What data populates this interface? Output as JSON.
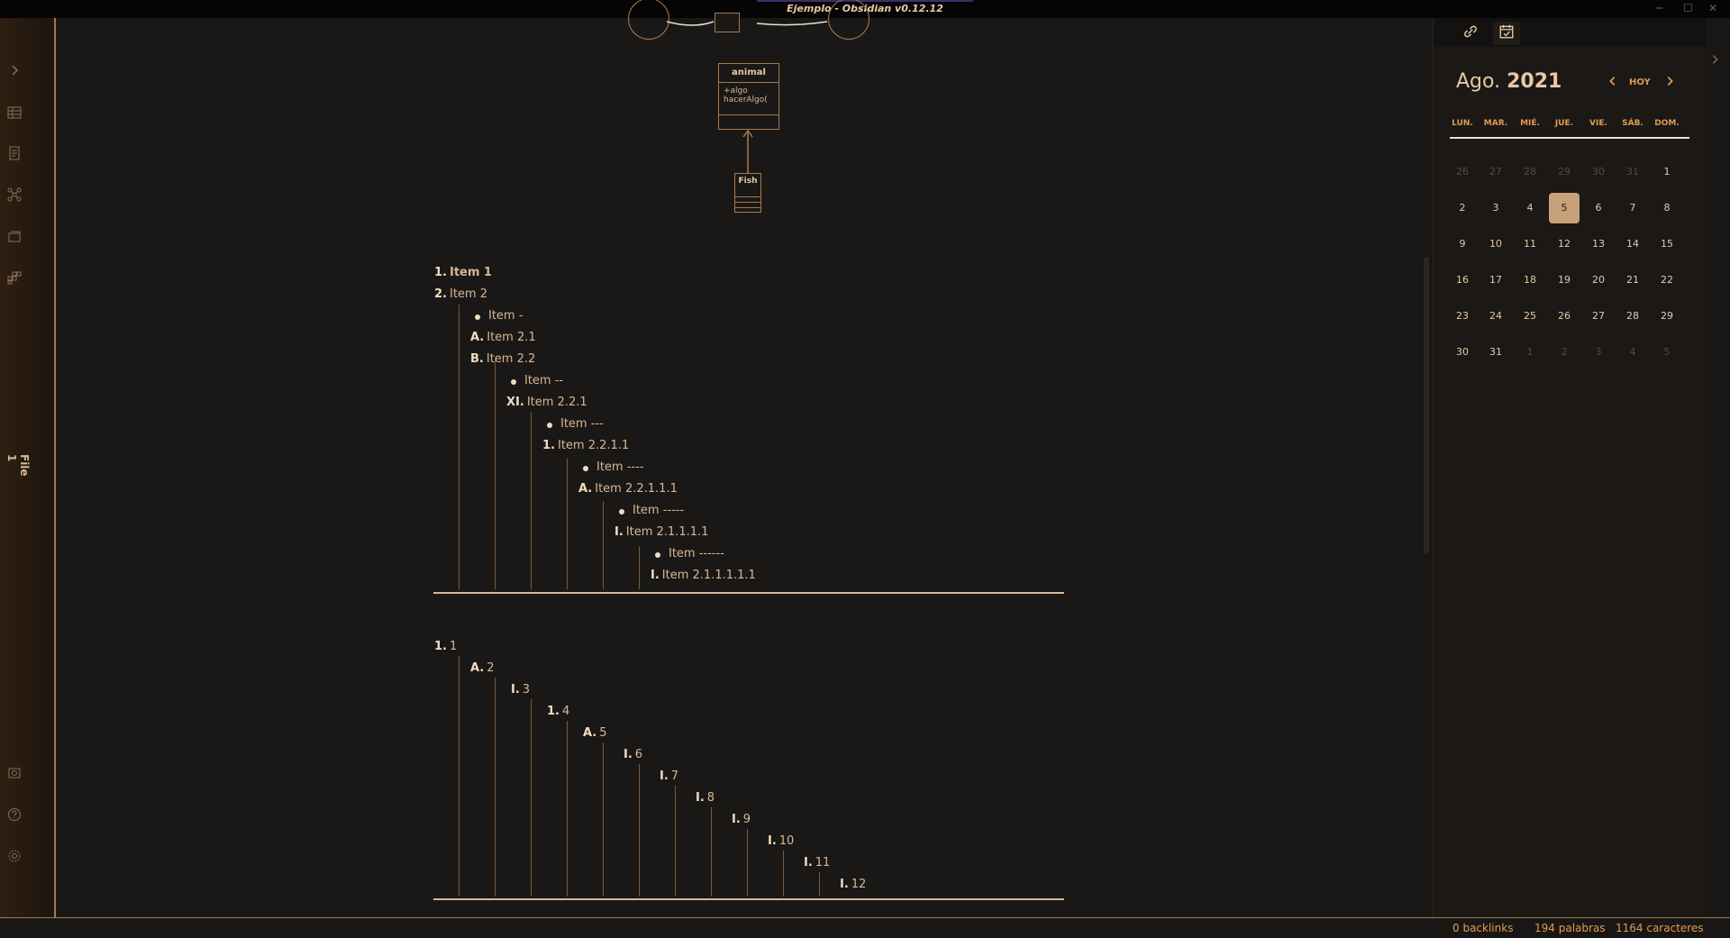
{
  "window": {
    "title": "Ejemplo - Obsidian v0.12.12",
    "minimize": "─",
    "maximize": "☐",
    "close": "✕"
  },
  "ribbon": {
    "file_label": "File 1",
    "icons": [
      "expand-sidebar-icon",
      "table-icon",
      "document-icon",
      "graph-icon",
      "cards-icon",
      "plugins-icon",
      "vault-icon",
      "help-icon",
      "settings-icon"
    ]
  },
  "diagram": {
    "class_name": "animal",
    "members": [
      "+algo",
      "hacerAlgo("
    ],
    "subclass": "Fish"
  },
  "list1": {
    "items": [
      {
        "marker": "1.",
        "text": "Item 1"
      },
      {
        "marker": "2.",
        "text": "Item 2"
      },
      {
        "marker": "",
        "text": "Item -"
      },
      {
        "marker": "A.",
        "text": "Item 2.1"
      },
      {
        "marker": "B.",
        "text": "Item 2.2"
      },
      {
        "marker": "",
        "text": "Item --"
      },
      {
        "marker": "XI.",
        "text": "Item 2.2.1"
      },
      {
        "marker": "",
        "text": "Item ---"
      },
      {
        "marker": "1.",
        "text": "Item 2.2.1.1"
      },
      {
        "marker": "",
        "text": "Item ----"
      },
      {
        "marker": "A.",
        "text": "Item 2.2.1.1.1"
      },
      {
        "marker": "",
        "text": "Item -----"
      },
      {
        "marker": "I.",
        "text": "Item 2.1.1.1.1"
      },
      {
        "marker": "",
        "text": "Item ------"
      },
      {
        "marker": "I.",
        "text": "Item 2.1.1.1.1.1"
      }
    ]
  },
  "list2": {
    "items": [
      {
        "marker": "1.",
        "text": "1"
      },
      {
        "marker": "A.",
        "text": "2"
      },
      {
        "marker": "I.",
        "text": "3"
      },
      {
        "marker": "1.",
        "text": "4"
      },
      {
        "marker": "A.",
        "text": "5"
      },
      {
        "marker": "I.",
        "text": "6"
      },
      {
        "marker": "I.",
        "text": "7"
      },
      {
        "marker": "I.",
        "text": "8"
      },
      {
        "marker": "I.",
        "text": "9"
      },
      {
        "marker": "I.",
        "text": "10"
      },
      {
        "marker": "I.",
        "text": "11"
      },
      {
        "marker": "I.",
        "text": "12"
      }
    ]
  },
  "calendar": {
    "month": "Ago.",
    "year": "2021",
    "today_label": "HOY",
    "weekdays": [
      "LUN.",
      "MAR.",
      "MIÉ.",
      "JUE.",
      "VIE.",
      "SÁB.",
      "DOM."
    ],
    "weeks": [
      [
        "26",
        "27",
        "28",
        "29",
        "30",
        "31",
        "1"
      ],
      [
        "2",
        "3",
        "4",
        "5",
        "6",
        "7",
        "8"
      ],
      [
        "9",
        "10",
        "11",
        "12",
        "13",
        "14",
        "15"
      ],
      [
        "16",
        "17",
        "18",
        "19",
        "20",
        "21",
        "22"
      ],
      [
        "23",
        "24",
        "25",
        "26",
        "27",
        "28",
        "29"
      ],
      [
        "30",
        "31",
        "1",
        "2",
        "3",
        "4",
        "5"
      ]
    ],
    "today": "5"
  },
  "status": {
    "backlinks": "0 backlinks",
    "words": "194 palabras",
    "chars": "1164 caracteres"
  }
}
